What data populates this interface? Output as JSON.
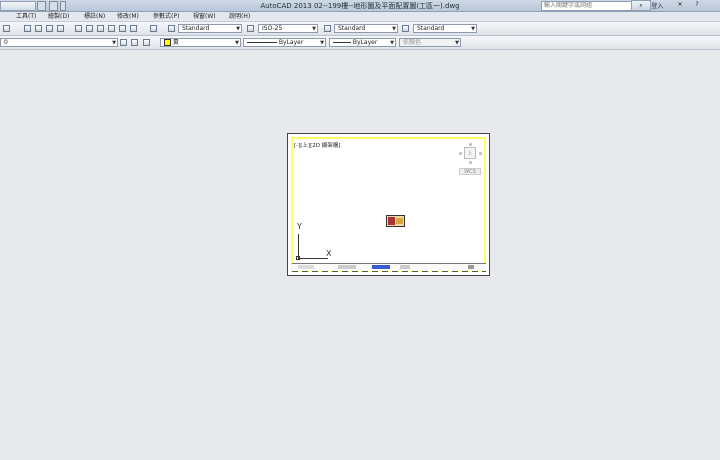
{
  "window": {
    "title": "AutoCAD 2013  02--199樓--地形圖及平面配置圖(工區一).dwg",
    "search_placeholder": "輸入關鍵字或詞組",
    "login_label": "登入"
  },
  "menu": {
    "items": [
      "工具(T)",
      "繪製(D)",
      "標註(N)",
      "修改(M)",
      "參數式(P)",
      "視窗(W)",
      "說明(H)"
    ]
  },
  "toolbar1": {
    "text_style": "Standard",
    "dim_style": "ISO-25",
    "table_style": "Standard",
    "multileader_style": "Standard"
  },
  "toolbar2": {
    "layer": "0",
    "color": "黃",
    "linetype": "ByLayer",
    "lineweight": "ByLayer",
    "plot_style": "依顏色"
  },
  "viewport": {
    "label": "[-][上][2D 線架構]",
    "wcs_label": "WCS",
    "ucs_y": "Y",
    "ucs_x": "X",
    "border_color": "#ffff66"
  }
}
